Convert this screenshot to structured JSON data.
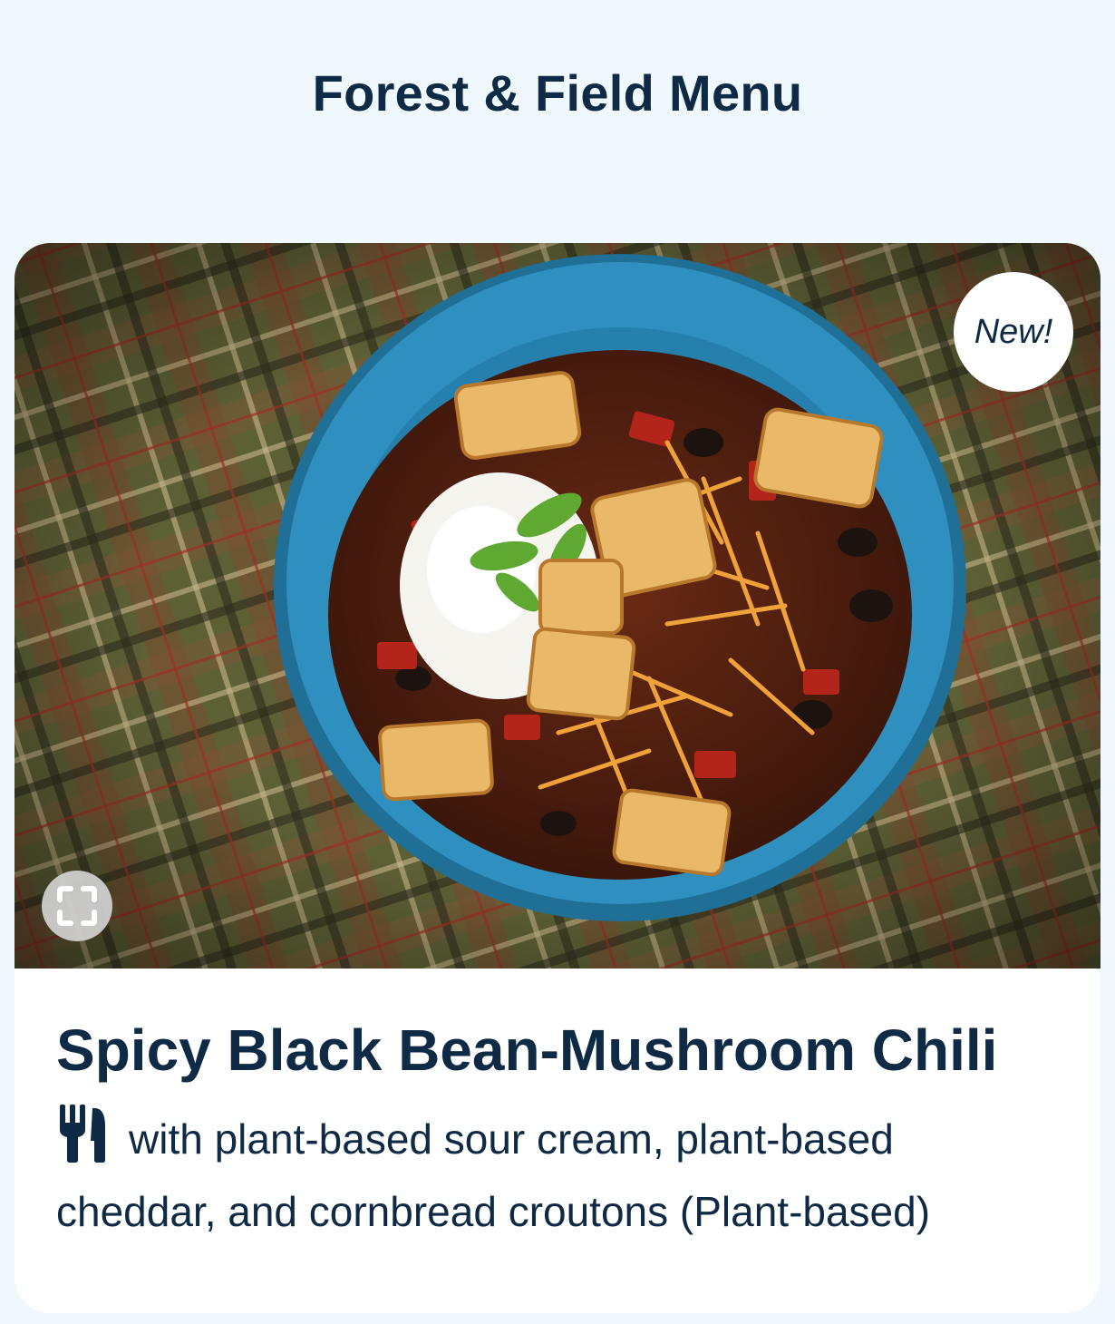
{
  "header": {
    "title": "Forest & Field Menu"
  },
  "card": {
    "badge": "New!",
    "image_alt": "Spicy black bean-mushroom chili in a blue bowl on plaid cloth",
    "expand_icon": "expand-icon",
    "title": "Spicy Black Bean-Mushroom Chili",
    "description_icon": "utensils-icon",
    "description": "with plant-based sour cream, plant-based cheddar, and cornbread croutons (Plant-based)"
  },
  "colors": {
    "background": "#eff9fd",
    "text": "#0f2a44",
    "card": "#ffffff",
    "bowl": "#2f8fbf"
  }
}
